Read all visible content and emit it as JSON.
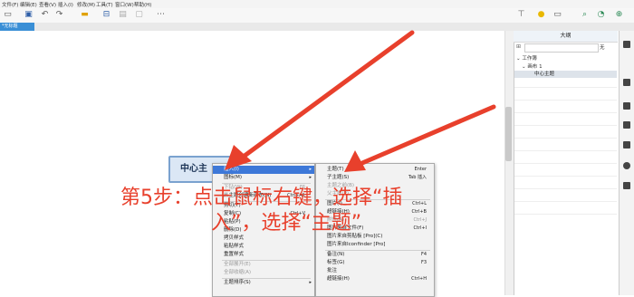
{
  "menubar": [
    "文件(F)",
    "编辑(E)",
    "查看(V)",
    "插入(I)",
    "修改(M)",
    "工具(T)",
    "窗口(W)",
    "帮助(H)"
  ],
  "tab": {
    "label": "*无标题"
  },
  "outline": {
    "title": "大纲",
    "filter_text": "无",
    "tree": [
      "工作簿",
      "画布 1",
      "中心主题"
    ]
  },
  "central_topic": {
    "label": "中心主"
  },
  "context_menu": {
    "items": [
      {
        "label": "插入(I)",
        "shortcut": "",
        "submenu": true,
        "state": "highlighted"
      },
      {
        "label": "图标(M)",
        "shortcut": "",
        "submenu": true,
        "state": "normal"
      },
      {
        "label": "下钻(W)",
        "shortcut": "F6",
        "submenu": false,
        "state": "disabled"
      },
      {
        "label": "从主题创建新画布(N)",
        "shortcut": "Ctrl+Alt",
        "submenu": false,
        "state": "normal"
      },
      {
        "label": "剪切(T)",
        "shortcut": "",
        "submenu": false,
        "state": "normal"
      },
      {
        "label": "复制(C)",
        "shortcut": "Ctrl+V",
        "submenu": false,
        "state": "normal"
      },
      {
        "label": "粘贴(P)",
        "shortcut": "",
        "submenu": false,
        "state": "normal"
      },
      {
        "label": "删除(D)",
        "shortcut": "",
        "submenu": false,
        "state": "normal"
      },
      {
        "label": "拷贝样式",
        "shortcut": "",
        "submenu": false,
        "state": "normal"
      },
      {
        "label": "粘贴样式",
        "shortcut": "",
        "submenu": false,
        "state": "normal"
      },
      {
        "label": "重置样式",
        "shortcut": "",
        "submenu": false,
        "state": "normal"
      },
      {
        "label": "全部展开(E)",
        "shortcut": "",
        "submenu": false,
        "state": "disabled"
      },
      {
        "label": "全部收缩(A)",
        "shortcut": "",
        "submenu": false,
        "state": "disabled"
      },
      {
        "label": "主题排序(S)",
        "shortcut": "",
        "submenu": true,
        "state": "normal"
      }
    ]
  },
  "submenu": {
    "items": [
      {
        "label": "主题(T)",
        "shortcut": "Enter",
        "state": "normal"
      },
      {
        "label": "子主题(S)",
        "shortcut": "Tab 插入",
        "state": "normal"
      },
      {
        "label": "主题之前(B)",
        "shortcut": "",
        "state": "disabled"
      },
      {
        "label": "父主题(P)",
        "shortcut": "",
        "state": "disabled"
      },
      {
        "label": "图片(I)",
        "shortcut": "Ctrl+L",
        "state": "normal"
      },
      {
        "label": "超链接(H)",
        "shortcut": "Ctrl+B",
        "state": "normal"
      },
      {
        "label": "附件(A)",
        "shortcut": "Ctrl+J",
        "state": "disabled"
      },
      {
        "label": "图片来自文件(F)",
        "shortcut": "Ctrl+I",
        "state": "normal"
      },
      {
        "label": "图片来自剪贴板 [Pro](C)",
        "shortcut": "",
        "state": "normal"
      },
      {
        "label": "图片来自Iconfinder [Pro]",
        "shortcut": "",
        "state": "normal"
      },
      {
        "label": "备注(N)",
        "shortcut": "F4",
        "state": "normal"
      },
      {
        "label": "标签(G)",
        "shortcut": "F3",
        "state": "normal"
      },
      {
        "label": "批注",
        "shortcut": "",
        "state": "normal"
      },
      {
        "label": "超链接(H)",
        "shortcut": "Ctrl+H",
        "state": "normal"
      }
    ]
  },
  "annotation": {
    "line1": "第5步：点击鼠标右键，选择“插",
    "line2": "入”，选择“主题”"
  },
  "colors": {
    "accent": "#3d78d8",
    "annotation": "#e8402c",
    "topic_fill": "#dbe7f5"
  }
}
